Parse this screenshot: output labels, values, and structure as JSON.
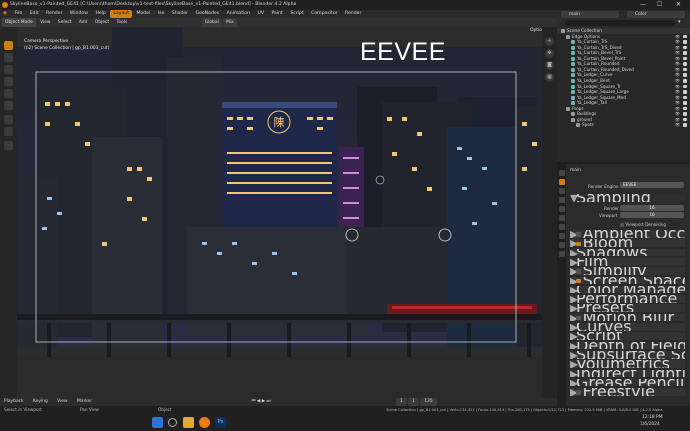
{
  "window": {
    "title": "SkylineBase_v1-Painted_GE41 [C:\\Users\\thom\\Desktop\\v1-test-files\\SkylineBase_v1-Painted_GE41.blend] - Blender 4.2 Alpha",
    "minimize": "—",
    "maximize": "☐",
    "close": "✕"
  },
  "menubar": {
    "items": [
      "File",
      "Edit",
      "Render",
      "Window",
      "Help"
    ],
    "workspaces": [
      "Layout",
      "Model",
      "Ise",
      "Shader",
      "GeoNodes",
      "Animation",
      "UV",
      "Paint",
      "Script",
      "Compositor",
      "Render"
    ],
    "active_workspace": "Layout",
    "scene": "main",
    "view_layer": "Color"
  },
  "viewport_header": {
    "mode": "Object Mode",
    "menus": [
      "View",
      "Select",
      "Add",
      "Object",
      "Tools"
    ],
    "orientation": "Global",
    "pivot": "Mix",
    "options": "Options"
  },
  "viewport": {
    "camera_line1": "Camera Perspective",
    "camera_line2": "(n2) Scene Collection | gp_B1.003_cut)",
    "engine_overlay": "EEVEE"
  },
  "outliner": {
    "search_placeholder": "",
    "rows": [
      {
        "label": "Scene Collection",
        "indent": 0,
        "color": "#9a9a9a"
      },
      {
        "label": "Edge Options",
        "indent": 1,
        "color": "#9a9a9a"
      },
      {
        "label": "Ya_Curtain_TrS",
        "indent": 2,
        "color": "#6fb0b0"
      },
      {
        "label": "Ya_Curtain_TrS_Dived",
        "indent": 2,
        "color": "#6fb0b0"
      },
      {
        "label": "Ya_Curtain_Bevel_TrS",
        "indent": 2,
        "color": "#6fb0b0"
      },
      {
        "label": "Ya_Curtain_Bevel_Point",
        "indent": 2,
        "color": "#6fb0b0"
      },
      {
        "label": "Ya_Curtain_Rounded",
        "indent": 2,
        "color": "#6fb0b0"
      },
      {
        "label": "Ya_Curtain_Rounded_Dived",
        "indent": 2,
        "color": "#6fb0b0"
      },
      {
        "label": "Ya_Ledger_Curve",
        "indent": 2,
        "color": "#6fb0b0"
      },
      {
        "label": "Ya_Ledger_Bent",
        "indent": 2,
        "color": "#6fb0b0"
      },
      {
        "label": "Ya_Ledger_Square_Tr",
        "indent": 2,
        "color": "#6fb0b0"
      },
      {
        "label": "Ya_Ledger_Square_Large",
        "indent": 2,
        "color": "#6fb0b0"
      },
      {
        "label": "Ya_Ledger_Square_Med",
        "indent": 2,
        "color": "#6fb0b0"
      },
      {
        "label": "Ya_Ledger_Tall",
        "indent": 2,
        "color": "#6fb0b0"
      },
      {
        "label": "Props",
        "indent": 1,
        "color": "#9a9a9a"
      },
      {
        "label": "Buildings",
        "indent": 2,
        "color": "#9a9a9a"
      },
      {
        "label": "ground",
        "indent": 2,
        "color": "#9a9a9a"
      },
      {
        "label": "Spots",
        "indent": 3,
        "color": "#9a9a9a"
      }
    ]
  },
  "properties": {
    "search_value": "main",
    "render_engine_label": "Render Engine",
    "render_engine": "EEVEE",
    "sampling": "Sampling",
    "render_label": "Render",
    "render_samples": "16",
    "viewport_label": "Viewport",
    "viewport_samples": "16",
    "viewport_denoising": "Viewport Denoising",
    "sections": [
      {
        "label": "Ambient Occlusion",
        "checkbox": true,
        "checked": false
      },
      {
        "label": "Bloom",
        "checkbox": true,
        "checked": true
      },
      {
        "label": "Shadows",
        "checkbox": false,
        "checked": false
      },
      {
        "label": "Film",
        "checkbox": false,
        "checked": false
      },
      {
        "label": "Simplify",
        "checkbox": true,
        "checked": false
      },
      {
        "label": "Screen Space Reflections",
        "checkbox": true,
        "checked": true
      },
      {
        "label": "Color Management",
        "checkbox": false,
        "checked": false
      },
      {
        "label": "Performance",
        "checkbox": false,
        "checked": false
      },
      {
        "label": "Presets",
        "checkbox": false,
        "checked": false
      },
      {
        "label": "Motion Blur",
        "checkbox": true,
        "checked": false
      },
      {
        "label": "Curves",
        "checkbox": false,
        "checked": false
      },
      {
        "label": "Script",
        "checkbox": false,
        "checked": false
      },
      {
        "label": "Depth of Field",
        "checkbox": false,
        "checked": false
      },
      {
        "label": "Subsurface Scattering",
        "checkbox": false,
        "checked": false
      },
      {
        "label": "Volumetrics",
        "checkbox": false,
        "checked": false
      },
      {
        "label": "Indirect Lighting",
        "checkbox": false,
        "checked": false
      },
      {
        "label": "Grease Pencil",
        "checkbox": false,
        "checked": false
      },
      {
        "label": "Freestyle",
        "checkbox": true,
        "checked": false
      }
    ]
  },
  "timeline": {
    "items": [
      "Playback",
      "Keying",
      "View",
      "Marker"
    ],
    "frame": "1",
    "start": "1",
    "end": "135"
  },
  "statusbar": {
    "left1": "Select in Viewport",
    "left2": "Pan View",
    "left3": "Object",
    "right": "Scene Collection | gp_B1.003_cut | Verts:134,451 | Faces:144,419 | Tris:260,175 | Objects:0/12,723 | Memory: 232.9 MiB | VRAM: 3.0/8.0 GiB | 4.2.0 Alpha"
  },
  "taskbar": {
    "time": "12:18 PM",
    "date": "1/6/2024"
  },
  "colors": {
    "accent": "#cf7f17",
    "panel": "#2b2b2b",
    "window_lit": "#f2c773",
    "window_blue": "#9bc4ee"
  },
  "sign_glyph": "陳"
}
